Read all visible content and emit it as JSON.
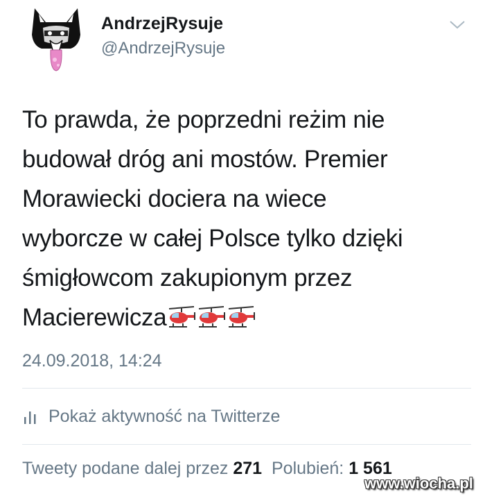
{
  "author": {
    "display_name": "AndrzejRysuje",
    "handle": "@AndrzejRysuje"
  },
  "tweet": {
    "lines": [
      "To prawda, że poprzedni reżim nie",
      "budował dróg ani mostów. Premier",
      "Morawiecki dociera na wiece",
      "wyborcze w całej Polsce tylko dzięki",
      "śmigłowcom zakupionym przez",
      "Macierewicza"
    ],
    "emoji": [
      "helicopter-icon",
      "helicopter-icon",
      "helicopter-icon"
    ],
    "timestamp": "24.09.2018, 14:24"
  },
  "activity": {
    "label": "Pokaż aktywność na Twitterze",
    "icon": "bar-chart-icon"
  },
  "stats": {
    "retweets_label": "Tweety podane dalej przez",
    "retweets_count": "271",
    "likes_label": "Polubień:",
    "likes_count": "1 561"
  },
  "watermark": "www.wiocha.pl",
  "colors": {
    "text": "#14171a",
    "secondary": "#657786",
    "divider": "#e1e8ed",
    "helicopter": "#e0393a"
  }
}
